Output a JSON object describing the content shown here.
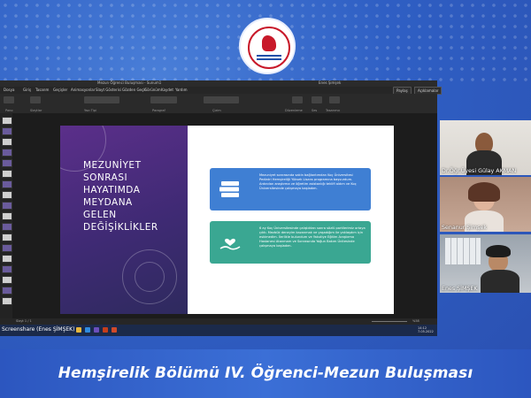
{
  "caption": "Hemşirelik Bölümü IV. Öğrenci-Mezun Buluşması",
  "ppt": {
    "title_doc": "Mezun Öğrenci Buluşması - Sunum1",
    "user": "Enes Şimşek",
    "menu": [
      "Dosya",
      "Giriş",
      "Tasarım",
      "Geçişler",
      "Animasyonlar",
      "Slayt Gösterisi",
      "Gözden Geçir",
      "Görünüm",
      "Kaydet",
      "Yardım"
    ],
    "share_label": "Paylaş",
    "comments_label": "Açıklamalar",
    "ribbon_groups": [
      "Pano",
      "Slaytlar",
      "Yazı Tipi",
      "Paragraf",
      "Çizim",
      "Düzenleme",
      "Ses",
      "Tasarımcı"
    ],
    "status_left": "Slayt 1 / 1",
    "zoom": "%58"
  },
  "slide": {
    "title_lines": [
      "MEZUNİYET",
      "SONRASI",
      "HAYATIMDA",
      "MEYDANA",
      "GELEN",
      "DEĞİŞİKLİKLER"
    ],
    "card1_text": "Mezuniyet sonrasında sakin bağlantımdan Koç Üniversitesi Pediatri Hemşireliği Yüksek Lisans programına başvurdum. Ardından araştırma ve öğretim asistanlığı teklifi aldım ve Koç Üniversitesinde çalışmaya başladım.",
    "card2_text": "6 ay Koç Üniversitesinde çalıştıktan sonra sözlü partilerimiz ortaya çıktı. Mezbük deneyim kazanmak ve yaşadığım ile yaklaşdım için eskimedim. İlerlikle bulundum ve Yakutiye Eğitim Araştırma Hastanesi Atanmam ve Sonrasında Yoğun Bakım Ünitesinde çalışmaya başladım."
  },
  "participants": [
    {
      "name": "Dr.Öğr.Üyesi Gülay AKMAN"
    },
    {
      "name": "Senanur Şimşek"
    },
    {
      "name": "Enes ŞİMŞEK"
    }
  ],
  "taskbar": {
    "screenshare": "Screenshare (Enes ŞİMŞEK)",
    "time": "14:12",
    "date": "7.05.2022"
  },
  "colors": {
    "background": "#2f5fc4",
    "slide_purple": "#4a2c7e",
    "card_blue": "#3f7fd3",
    "card_green": "#3aa792"
  }
}
